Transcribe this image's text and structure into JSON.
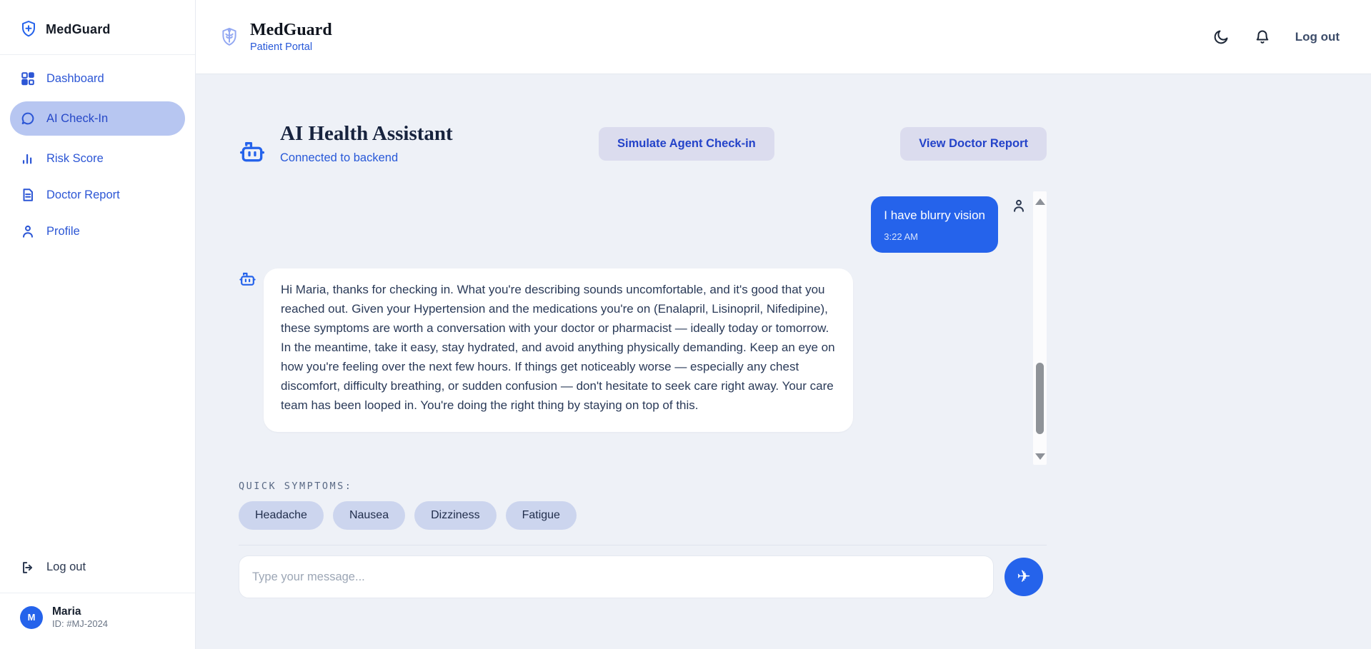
{
  "sidebar": {
    "brand": "MedGuard",
    "nav": [
      {
        "label": "Dashboard",
        "icon": "dashboard-icon"
      },
      {
        "label": "AI Check-In",
        "icon": "chat-bubble-icon"
      },
      {
        "label": "Risk Score",
        "icon": "bar-chart-icon"
      },
      {
        "label": "Doctor Report",
        "icon": "document-icon"
      },
      {
        "label": "Profile",
        "icon": "person-icon"
      }
    ],
    "logout_label": "Log out",
    "user": {
      "initial": "M",
      "name": "Maria",
      "id": "ID: #MJ-2024"
    }
  },
  "header": {
    "brand": "MedGuard",
    "subtitle": "Patient Portal",
    "logout_label": "Log out"
  },
  "assistant": {
    "title": "AI Health Assistant",
    "status": "Connected to backend",
    "simulate_button": "Simulate Agent Check-in",
    "report_button": "View Doctor Report"
  },
  "chat": {
    "user_message": {
      "text": "I have blurry vision",
      "time": "3:22 AM"
    },
    "ai_message": {
      "text": "Hi Maria, thanks for checking in. What you're describing sounds uncomfortable, and it's good that you reached out. Given your Hypertension and the medications you're on (Enalapril, Lisinopril, Nifedipine), these symptoms are worth a conversation with your doctor or pharmacist — ideally today or tomorrow. In the meantime, take it easy, stay hydrated, and avoid anything physically demanding. Keep an eye on how you're feeling over the next few hours. If things get noticeably worse — especially any chest discomfort, difficulty breathing, or sudden confusion — don't hesitate to seek care right away. Your care team has been looped in. You're doing the right thing by staying on top of this."
    }
  },
  "quick_symptoms": {
    "label": "QUICK SYMPTOMS:",
    "items": [
      "Headache",
      "Nausea",
      "Dizziness",
      "Fatigue"
    ]
  },
  "composer": {
    "placeholder": "Type your message...",
    "send_icon": "paper-plane-icon",
    "send_glyph": "✈"
  },
  "colors": {
    "primary_blue": "#2563eb",
    "nav_blue": "#2c56d5",
    "active_pill": "#b7c6f1",
    "button_bg": "#dbdcee",
    "symptom_pill_bg": "#ccd5ee",
    "main_background": "#eef1f7",
    "dark_heading": "#17233e"
  }
}
